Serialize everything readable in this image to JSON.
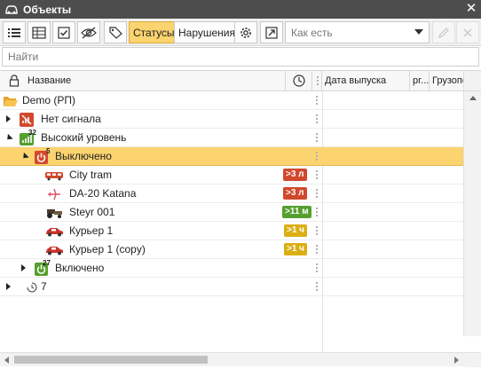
{
  "window": {
    "title": "Объекты",
    "icon": "car-icon",
    "close_icon": "close-icon",
    "close_glyph": "✕"
  },
  "toolbar": {
    "buttons": [
      {
        "icon": "list-icon"
      },
      {
        "icon": "table-icon"
      },
      {
        "icon": "checkbox-icon"
      },
      {
        "icon": "eye-hidden-icon"
      },
      {
        "icon": "tag-icon"
      }
    ],
    "statuses_label": "Статусы",
    "violations_label": "Нарушения",
    "settings_icon": "gear-icon",
    "export_icon": "export-arrow-icon",
    "dropdown_value": "Как есть",
    "edit_icon": "pencil-icon",
    "delete_icon": "close-icon"
  },
  "search": {
    "placeholder": "Найти"
  },
  "columns": {
    "name": "Название",
    "release_date": "Дата выпуска",
    "col3": "pr...",
    "col4": "Грузопо",
    "lock_icon": "lock-icon",
    "clock_icon": "clock-icon"
  },
  "rows": [
    {
      "label": "Demo (РП)",
      "icon": "folder-icon",
      "count": "",
      "expander": "none",
      "level": 0
    },
    {
      "label": "Нет сигнала",
      "icon": "no-signal-icon",
      "count": "",
      "expander": "collapsed",
      "level": 0
    },
    {
      "label": "Высокий уровень",
      "icon": "signal-high-icon",
      "count": "32",
      "expander": "expanded",
      "level": 0
    },
    {
      "label": "Выключено",
      "icon": "power-off-icon",
      "count": "5",
      "expander": "expanded",
      "level": 1
    },
    {
      "label": "City tram",
      "icon": "tram-icon",
      "badge": ">3 л",
      "badge_color": "red",
      "level": 2
    },
    {
      "label": "DA-20 Katana",
      "icon": "plane-icon",
      "badge": ">3 л",
      "badge_color": "red",
      "level": 2
    },
    {
      "label": "Steyr 001",
      "icon": "tractor-icon",
      "badge": ">11 м",
      "badge_color": "green",
      "level": 2
    },
    {
      "label": "Курьер 1",
      "icon": "car-red-icon",
      "badge": ">1 ч",
      "badge_color": "yellow",
      "level": 2
    },
    {
      "label": "Курьер 1 (copy)",
      "icon": "car-red-icon",
      "badge": ">1 ч",
      "badge_color": "yellow",
      "level": 2
    },
    {
      "label": "Включено",
      "icon": "power-on-icon",
      "count": "27",
      "expander": "collapsed",
      "level": 1
    },
    {
      "label": "7",
      "icon": "clock-small-icon",
      "count": "",
      "expander": "collapsed",
      "level": 0
    }
  ],
  "colors": {
    "accent": "#fbd36f",
    "titlebar": "#4d4d4d",
    "red": "#d2482c",
    "green": "#55a02e",
    "yellow": "#dbae14"
  }
}
